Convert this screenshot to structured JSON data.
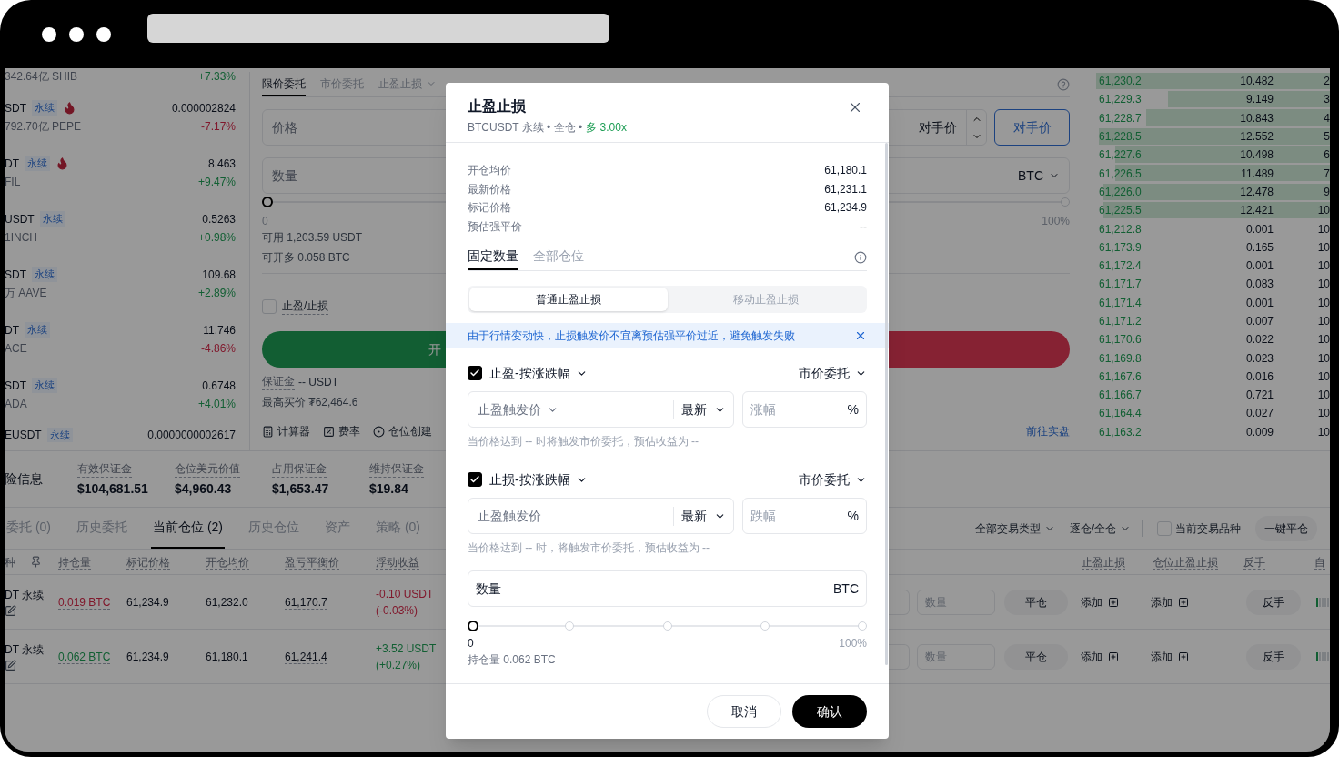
{
  "market_list": {
    "top_row": {
      "sub": "342.64亿 SHIB",
      "change": "+7.33%",
      "rising": true
    },
    "rows": [
      {
        "symbol": "SDT",
        "tag": "永续",
        "hot": true,
        "sub": "792.70亿 PEPE",
        "price": "0.000002824",
        "change": "-7.17%",
        "rising": false
      },
      {
        "symbol": "DT",
        "tag": "永续",
        "hot": true,
        "sub": "FIL",
        "price": "8.463",
        "change": "+9.47%",
        "rising": true
      },
      {
        "symbol": "USDT",
        "tag": "永续",
        "hot": false,
        "sub": "1INCH",
        "price": "0.5263",
        "change": "+0.98%",
        "rising": true
      },
      {
        "symbol": "SDT",
        "tag": "永续",
        "hot": false,
        "sub": "万 AAVE",
        "price": "109.68",
        "change": "+2.89%",
        "rising": true
      },
      {
        "symbol": "DT",
        "tag": "永续",
        "hot": false,
        "sub": "ACE",
        "price": "11.746",
        "change": "-4.86%",
        "rising": false
      },
      {
        "symbol": "SDT",
        "tag": "永续",
        "hot": false,
        "sub": "ADA",
        "price": "0.6748",
        "change": "+4.01%",
        "rising": true
      }
    ],
    "bottom_row": {
      "symbol": "EUSDT",
      "tag": "永续",
      "price": "0.0000000002617"
    }
  },
  "order_form": {
    "tabs": [
      {
        "label": "限价委托",
        "selected": true,
        "dropdown": false
      },
      {
        "label": "市价委托",
        "selected": false,
        "dropdown": false
      },
      {
        "label": "止盈止损",
        "selected": false,
        "dropdown": true
      }
    ],
    "price_field": {
      "placeholder": "价格",
      "price_type": "对手价"
    },
    "counter_button": "对手价",
    "quantity_field": {
      "placeholder": "数量",
      "unit": "BTC"
    },
    "slider": {
      "level": 0,
      "min_label": "0",
      "max_label": "100%"
    },
    "available": {
      "label": "可用",
      "value": "1,203.59 USDT"
    },
    "max_open": {
      "label": "可开多",
      "value": "0.058 BTC"
    },
    "tpsl_checkbox": {
      "label": "止盈/止损",
      "checked": false
    },
    "buy_button": "开",
    "margin": {
      "label": "保证金",
      "value": "-- USDT"
    },
    "max_buy": {
      "label": "最高买价",
      "value": "₮62,464.6"
    },
    "tools": [
      {
        "label": "计算器",
        "kind": "calculator"
      },
      {
        "label": "费率",
        "kind": "rate"
      },
      {
        "label": "仓位创建",
        "kind": "position"
      }
    ],
    "demo_link": "前往实盘"
  },
  "order_book": [
    {
      "price": "61,230.2",
      "amount": "10.482",
      "total": "2"
    },
    {
      "price": "61,229.3",
      "amount": "9.149",
      "total": "3"
    },
    {
      "price": "61,228.7",
      "amount": "10.843",
      "total": "4"
    },
    {
      "price": "61,228.5",
      "amount": "12.552",
      "total": "5"
    },
    {
      "price": "61,227.6",
      "amount": "10.498",
      "total": "6"
    },
    {
      "price": "61,226.5",
      "amount": "11.489",
      "total": "7"
    },
    {
      "price": "61,226.0",
      "amount": "12.478",
      "total": "9"
    },
    {
      "price": "61,225.5",
      "amount": "12.421",
      "total": "10"
    },
    {
      "price": "61,212.8",
      "amount": "0.001",
      "total": "10"
    },
    {
      "price": "61,173.9",
      "amount": "0.165",
      "total": "10"
    },
    {
      "price": "61,172.4",
      "amount": "0.001",
      "total": "10"
    },
    {
      "price": "61,171.7",
      "amount": "0.083",
      "total": "10"
    },
    {
      "price": "61,171.4",
      "amount": "0.001",
      "total": "10"
    },
    {
      "price": "61,171.2",
      "amount": "0.007",
      "total": "10"
    },
    {
      "price": "61,170.6",
      "amount": "0.022",
      "total": "10"
    },
    {
      "price": "61,169.8",
      "amount": "0.023",
      "total": "10"
    },
    {
      "price": "61,167.6",
      "amount": "0.016",
      "total": "10"
    },
    {
      "price": "61,166.7",
      "amount": "0.721",
      "total": "10"
    },
    {
      "price": "61,164.4",
      "amount": "0.027",
      "total": "10"
    },
    {
      "price": "61,163.2",
      "amount": "0.009",
      "total": "10"
    }
  ],
  "risk": {
    "title": "险信息",
    "stats": [
      {
        "label": "有效保证金",
        "value": "$104,681.51"
      },
      {
        "label": "仓位美元价值",
        "value": "$4,960.43"
      },
      {
        "label": "占用保证金",
        "value": "$1,653.47"
      },
      {
        "label": "维持保证金",
        "value": "$19.84"
      }
    ]
  },
  "bottom_tabs": [
    {
      "label": "委托 (0)",
      "selected": false
    },
    {
      "label": "历史委托",
      "selected": false
    },
    {
      "label": "当前仓位 (2)",
      "selected": true
    },
    {
      "label": "历史仓位",
      "selected": false
    },
    {
      "label": "资产",
      "selected": false
    },
    {
      "label": "策略 (0)",
      "selected": false
    }
  ],
  "filters": {
    "type_filter": "全部交易类型",
    "margin_filter": "逐仓/全仓",
    "current_only": {
      "label": "当前交易品种",
      "checked": false
    },
    "close_all": "一键平仓"
  },
  "positions": {
    "columns_left": [
      "种",
      "持仓量",
      "标记价格",
      "开仓均价",
      "盈亏平衡价",
      "浮动收益"
    ],
    "columns_right": [
      "止盈止损",
      "仓位止盈止损",
      "反手",
      "自"
    ],
    "rows": [
      {
        "symbol": "DT 永续",
        "qty": "0.019 BTC",
        "profit": false,
        "mark": "61,234.9",
        "open": "61,232.0",
        "breakeven": "61,170.7",
        "pnl": "-0.10 USDT",
        "pnl_pct": "(-0.03%)",
        "qty_placeholder": "数量",
        "close": "平仓",
        "tp": "添加",
        "pos_tp": "添加",
        "reverse": "反手"
      },
      {
        "symbol": "DT 永续",
        "qty": "0.062 BTC",
        "profit": true,
        "mark": "61,234.9",
        "open": "61,180.1",
        "breakeven": "61,241.4",
        "pnl": "+3.52 USDT",
        "pnl_pct": "(+0.27%)",
        "qty_placeholder": "数量",
        "close": "平仓",
        "tp": "添加",
        "pos_tp": "添加",
        "reverse": "反手"
      }
    ]
  },
  "modal": {
    "title": "止盈止损",
    "subtitle": "BTCUSDT 永续 • 全仓 •",
    "leverage": "多 3.00x",
    "info": [
      {
        "label": "开仓均价",
        "value": "61,180.1"
      },
      {
        "label": "最新价格",
        "value": "61,231.1"
      },
      {
        "label": "标记价格",
        "value": "61,234.9"
      },
      {
        "label": "预估强平价",
        "value": "--"
      }
    ],
    "tabs": [
      {
        "label": "固定数量",
        "selected": true
      },
      {
        "label": "全部仓位",
        "selected": false
      }
    ],
    "modes": [
      {
        "label": "普通止盈止损",
        "selected": true
      },
      {
        "label": "移动止盈止损",
        "selected": false
      }
    ],
    "notice": "由于行情变动快，止损触发价不宜离预估强平价过近，避免触发失败",
    "sections": [
      {
        "checked": true,
        "label": "止盈-按涨跌幅",
        "order_type": "市价委托",
        "trigger": "止盈触发价",
        "trigger_dropdown": true,
        "source": "最新",
        "pct_placeholder": "涨幅",
        "unit": "%",
        "hint": "当价格达到 -- 时将触发市价委托，预估收益为 --"
      },
      {
        "checked": true,
        "label": "止损-按涨跌幅",
        "order_type": "市价委托",
        "trigger": "止盈触发价",
        "trigger_dropdown": false,
        "source": "最新",
        "pct_placeholder": "跌幅",
        "unit": "%",
        "hint": "当价格达到 -- 时，将触发市价委托，预估收益为 --"
      }
    ],
    "quantity": {
      "label": "数量",
      "unit": "BTC"
    },
    "slider": {
      "level": 0,
      "min_label": "0",
      "max_label": "100%"
    },
    "holding": "持仓量 0.062 BTC",
    "cancel": "取消",
    "confirm": "确认"
  }
}
